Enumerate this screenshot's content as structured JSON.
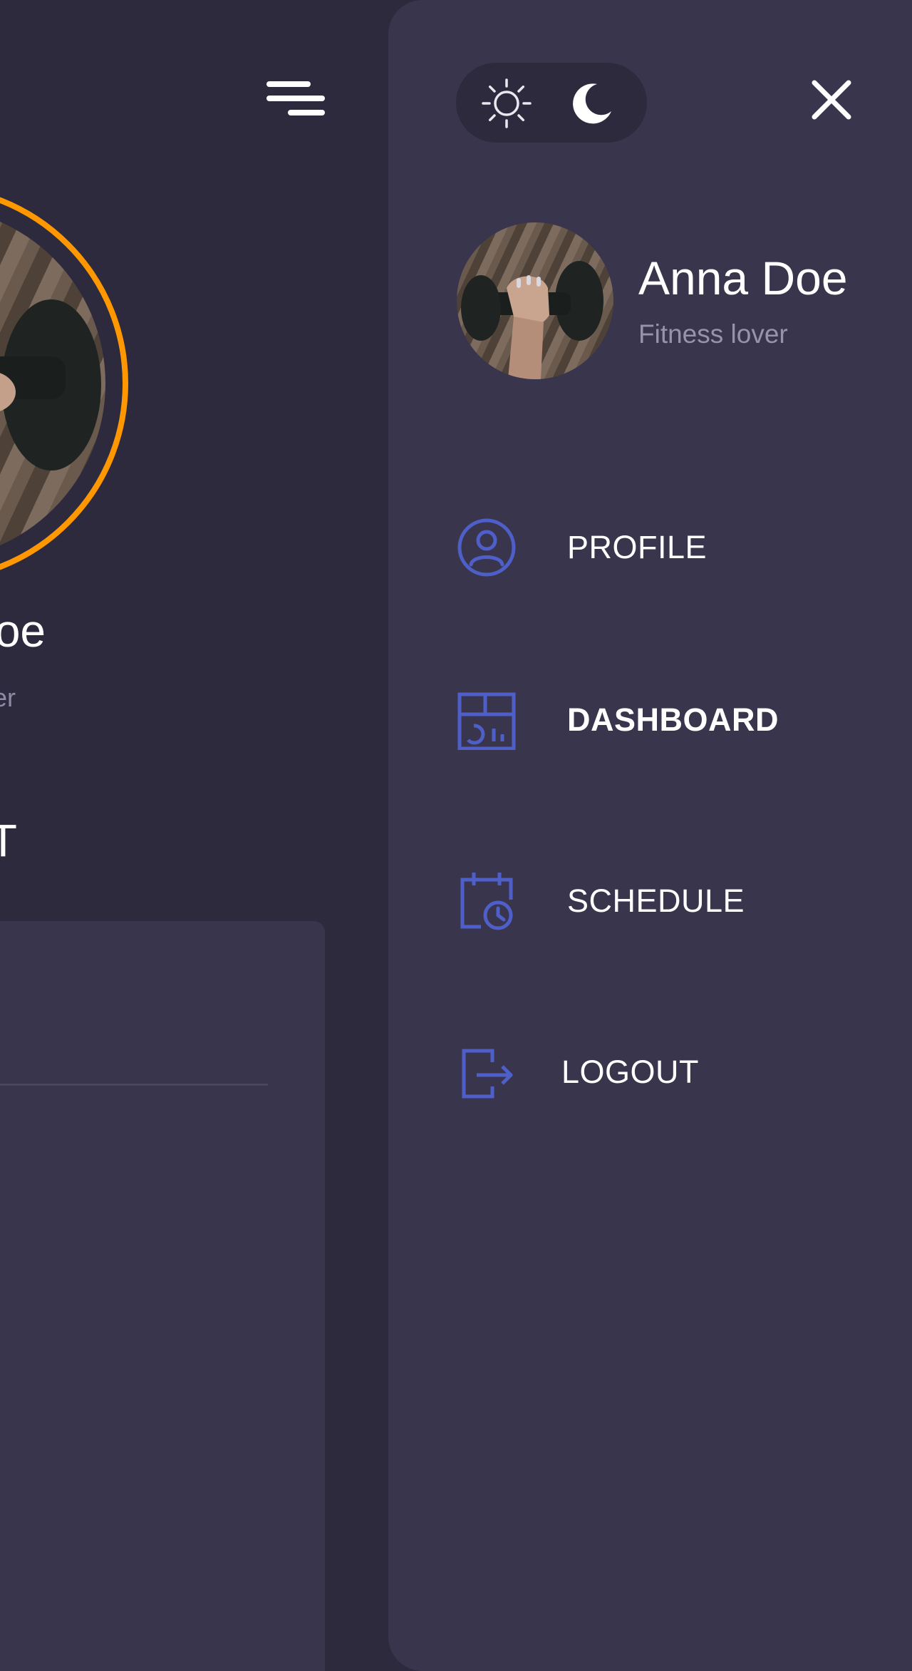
{
  "background_page": {
    "name_partial": "oe",
    "tagline_partial": "er",
    "heading_partial": "T",
    "menu_icon": "menu-lines-icon",
    "accent_ring_color": "#ff9800"
  },
  "drawer": {
    "theme_toggle": {
      "light_icon": "sun-icon",
      "dark_icon": "moon-icon",
      "selected": "dark"
    },
    "close_icon": "close-icon",
    "profile": {
      "name": "Anna Doe",
      "tagline": "Fitness lover"
    },
    "nav": [
      {
        "label": "PROFILE",
        "icon": "user-circle-icon",
        "active": false
      },
      {
        "label": "DASHBOARD",
        "icon": "dashboard-icon",
        "active": true
      },
      {
        "label": "SCHEDULE",
        "icon": "calendar-clock-icon",
        "active": false
      },
      {
        "label": "LOGOUT",
        "icon": "logout-icon",
        "active": false
      }
    ]
  },
  "colors": {
    "background": "#2e2a3d",
    "drawer": "#38354c",
    "icon_accent": "#4f5fc9",
    "accent": "#ff9800"
  }
}
